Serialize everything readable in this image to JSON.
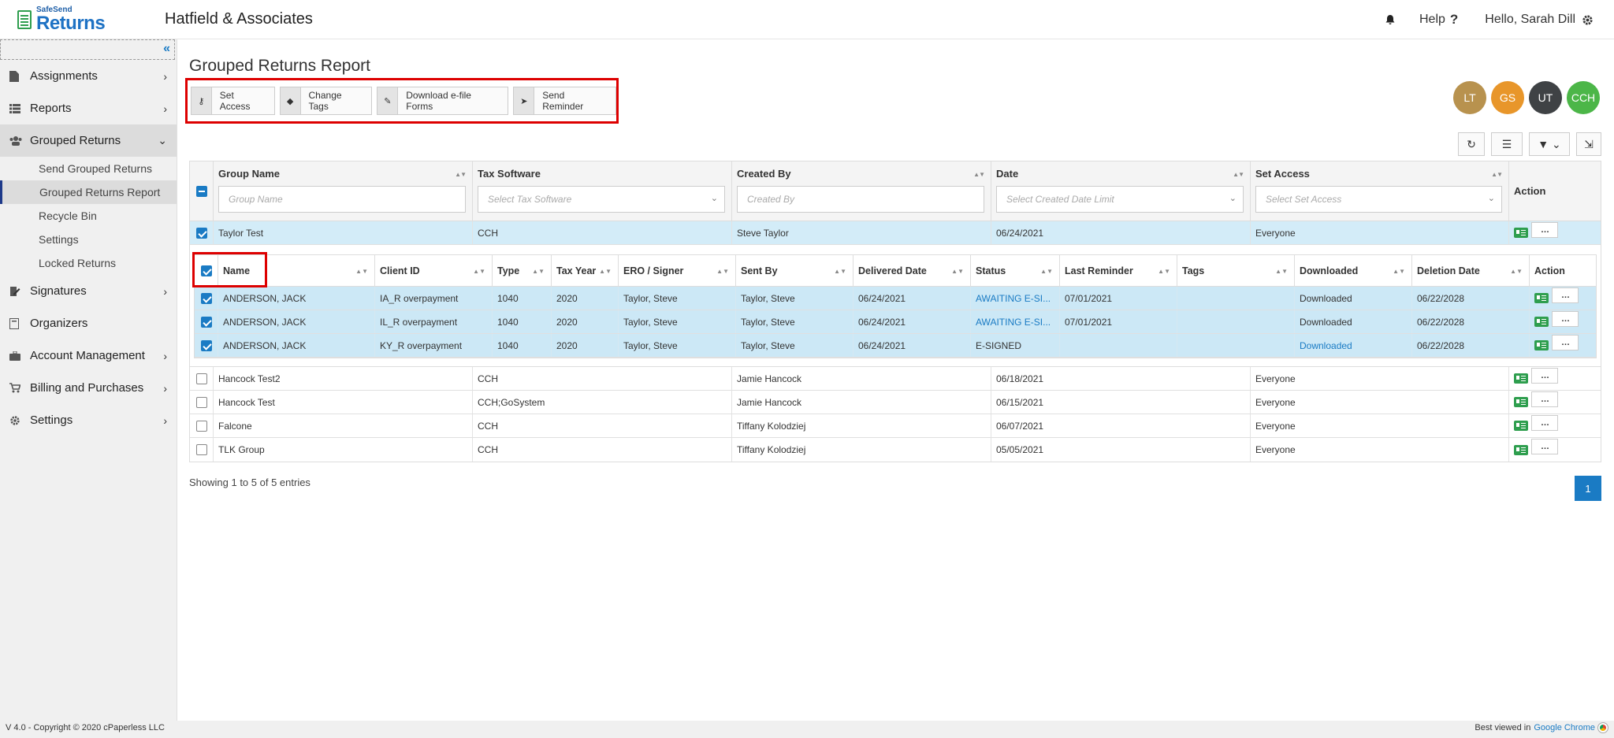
{
  "header": {
    "logo_small": "SafeSend",
    "logo_big": "Returns",
    "company": "Hatfield & Associates",
    "help": "Help",
    "user": "Hello, Sarah Dill"
  },
  "sidebar": {
    "collapse": "«",
    "items": [
      {
        "label": "Assignments"
      },
      {
        "label": "Reports"
      },
      {
        "label": "Grouped Returns"
      },
      {
        "label": "Signatures"
      },
      {
        "label": "Organizers"
      },
      {
        "label": "Account Management"
      },
      {
        "label": "Billing and Purchases"
      },
      {
        "label": "Settings"
      }
    ],
    "sub_items": [
      {
        "label": "Send Grouped Returns"
      },
      {
        "label": "Grouped Returns Report"
      },
      {
        "label": "Recycle Bin"
      },
      {
        "label": "Settings"
      },
      {
        "label": "Locked Returns"
      }
    ]
  },
  "page_title": "Grouped Returns Report",
  "toolbar": {
    "set_access": "Set Access",
    "change_tags": "Change Tags",
    "download_efile": "Download e-file Forms",
    "send_reminder": "Send Reminder"
  },
  "avatars": [
    {
      "label": "LT",
      "color": "#b8924e"
    },
    {
      "label": "GS",
      "color": "#e8962a"
    },
    {
      "label": "UT",
      "color": "#3f4245"
    },
    {
      "label": "CCH",
      "color": "#4cb648"
    }
  ],
  "grid": {
    "columns": {
      "group_name": "Group Name",
      "tax_software": "Tax Software",
      "created_by": "Created By",
      "date": "Date",
      "set_access": "Set Access",
      "action": "Action"
    },
    "filters": {
      "group_name": "Group Name",
      "tax_software": "Select Tax Software",
      "created_by": "Created By",
      "date": "Select Created Date Limit",
      "set_access": "Select Set Access"
    },
    "expanded_row": {
      "group": "Taylor Test",
      "software": "CCH",
      "created_by": "Steve Taylor",
      "date": "06/24/2021",
      "access": "Everyone"
    },
    "rows": [
      {
        "group": "Hancock Test2",
        "software": "CCH",
        "created_by": "Jamie Hancock",
        "date": "06/18/2021",
        "access": "Everyone"
      },
      {
        "group": "Hancock Test",
        "software": "CCH;GoSystem",
        "created_by": "Jamie Hancock",
        "date": "06/15/2021",
        "access": "Everyone"
      },
      {
        "group": "Falcone",
        "software": "CCH",
        "created_by": "Tiffany Kolodziej",
        "date": "06/07/2021",
        "access": "Everyone"
      },
      {
        "group": "TLK Group",
        "software": "CCH",
        "created_by": "Tiffany Kolodziej",
        "date": "05/05/2021",
        "access": "Everyone"
      }
    ]
  },
  "subgrid": {
    "columns": {
      "name": "Name",
      "client_id": "Client ID",
      "type": "Type",
      "tax_year": "Tax Year",
      "ero": "ERO / Signer",
      "sent_by": "Sent By",
      "delivered": "Delivered Date",
      "status": "Status",
      "last_reminder": "Last Reminder",
      "tags": "Tags",
      "downloaded": "Downloaded",
      "deletion": "Deletion Date",
      "action": "Action"
    },
    "rows": [
      {
        "name": "ANDERSON, JACK",
        "client_id": "IA_R overpayment",
        "type": "1040",
        "year": "2020",
        "ero": "Taylor, Steve",
        "sent_by": "Taylor, Steve",
        "delivered": "06/24/2021",
        "status": "AWAITING E-SI...",
        "reminder": "07/01/2021",
        "tags": "",
        "downloaded": "Downloaded",
        "deletion": "06/22/2028"
      },
      {
        "name": "ANDERSON, JACK",
        "client_id": "IL_R overpayment",
        "type": "1040",
        "year": "2020",
        "ero": "Taylor, Steve",
        "sent_by": "Taylor, Steve",
        "delivered": "06/24/2021",
        "status": "AWAITING E-SI...",
        "reminder": "07/01/2021",
        "tags": "",
        "downloaded": "Downloaded",
        "deletion": "06/22/2028"
      },
      {
        "name": "ANDERSON, JACK",
        "client_id": "KY_R overpayment",
        "type": "1040",
        "year": "2020",
        "ero": "Taylor, Steve",
        "sent_by": "Taylor, Steve",
        "delivered": "06/24/2021",
        "status": "E-SIGNED",
        "reminder": "",
        "tags": "",
        "downloaded": "Downloaded",
        "deletion": "06/22/2028"
      }
    ]
  },
  "footer": {
    "showing": "Showing 1 to 5 of 5 entries",
    "page": "1",
    "copyright": "V 4.0 - Copyright © 2020 cPaperless LLC",
    "best_viewed": "Best viewed in",
    "browser": "Google Chrome"
  }
}
